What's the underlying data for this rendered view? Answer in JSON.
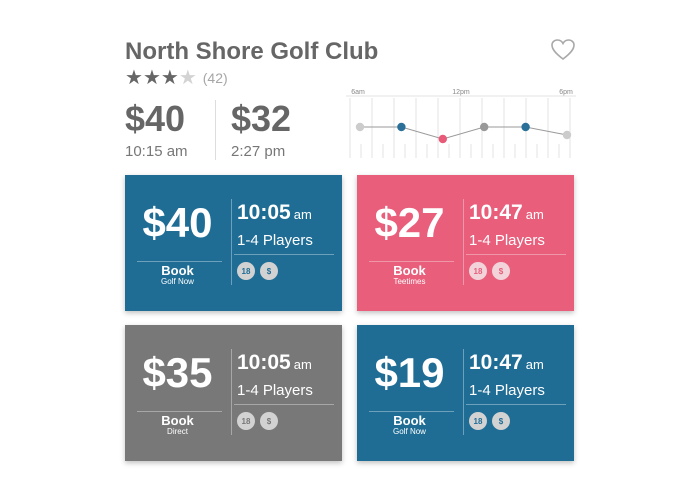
{
  "header": {
    "title": "North Shore Golf Club",
    "rating": 3,
    "rating_max": 5,
    "review_count": "(42)",
    "favorite_icon": "heart-outline-icon"
  },
  "summary": {
    "left": {
      "price": "$40",
      "time": "10:15 am"
    },
    "right": {
      "price": "$32",
      "time": "2:27 pm"
    }
  },
  "chart_data": {
    "type": "line",
    "x_tick_labels": [
      "6am",
      "12pm",
      "6pm"
    ],
    "points": [
      {
        "x": 0,
        "y": 0,
        "color": "#cccccc"
      },
      {
        "x": 1,
        "y": 0,
        "color": "#2a7099"
      },
      {
        "x": 2,
        "y": -0.75,
        "color": "#e85a78"
      },
      {
        "x": 3,
        "y": 0,
        "color": "#999999"
      },
      {
        "x": 4,
        "y": 0,
        "color": "#2a7099"
      },
      {
        "x": 5,
        "y": -0.5,
        "color": "#cccccc"
      }
    ],
    "grid": true
  },
  "cards": [
    {
      "price": "$40",
      "book": "Book",
      "source": "Golf Now",
      "time": "10:05",
      "ampm": "am",
      "players": "1-4 Players",
      "badges": [
        "18",
        "$"
      ],
      "bg": "#1f6d95",
      "badge_bg": "#d2d2d2",
      "badge_fg": "#1f6d95"
    },
    {
      "price": "$27",
      "book": "Book",
      "source": "Teetimes",
      "time": "10:47",
      "ampm": "am",
      "players": "1-4 Players",
      "badges": [
        "18",
        "$"
      ],
      "bg": "#e85e7b",
      "badge_bg": "#f2d3da",
      "badge_fg": "#e85e7b"
    },
    {
      "price": "$35",
      "book": "Book",
      "source": "Direct",
      "time": "10:05",
      "ampm": "am",
      "players": "1-4 Players",
      "badges": [
        "18",
        "$"
      ],
      "bg": "#787878",
      "badge_bg": "#d2d2d2",
      "badge_fg": "#787878"
    },
    {
      "price": "$19",
      "book": "Book",
      "source": "Golf Now",
      "time": "10:47",
      "ampm": "am",
      "players": "1-4 Players",
      "badges": [
        "18",
        "$"
      ],
      "bg": "#1f6d95",
      "badge_bg": "#d2d2d2",
      "badge_fg": "#1f6d95"
    }
  ]
}
